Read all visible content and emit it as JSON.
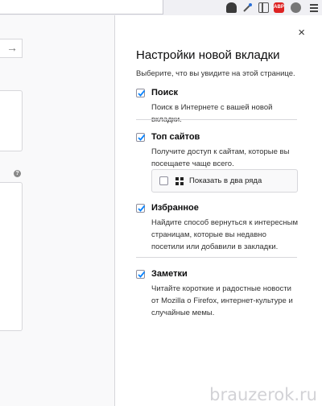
{
  "panel": {
    "title": "Настройки новой вкладки",
    "subtitle": "Выберите, что вы увидите на этой странице.",
    "close_label": "×",
    "sections": [
      {
        "title": "Поиск",
        "desc": "Поиск в Интернете с вашей новой вкладки.",
        "checked": true
      },
      {
        "title": "Топ сайтов",
        "desc": "Получите доступ к сайтам, которые вы посещаете чаще всего.",
        "checked": true
      },
      {
        "title": "Избранное",
        "desc": "Найдите способ вернуться к интересным страницам, которые вы недавно посетили или добавили в закладки.",
        "checked": true
      },
      {
        "title": "Заметки",
        "desc": "Читайте короткие и радостные новости от Mozilla о Firefox, интернет-культуре и случайные мемы.",
        "checked": true
      }
    ],
    "top_sites_option": {
      "label": "Показать в два ряда",
      "checked": false
    }
  },
  "left": {
    "search_arrow": "→",
    "help_icon": "?"
  },
  "toolbar": {
    "abp_label": "ABP"
  },
  "watermark": "brauzerok.ru"
}
